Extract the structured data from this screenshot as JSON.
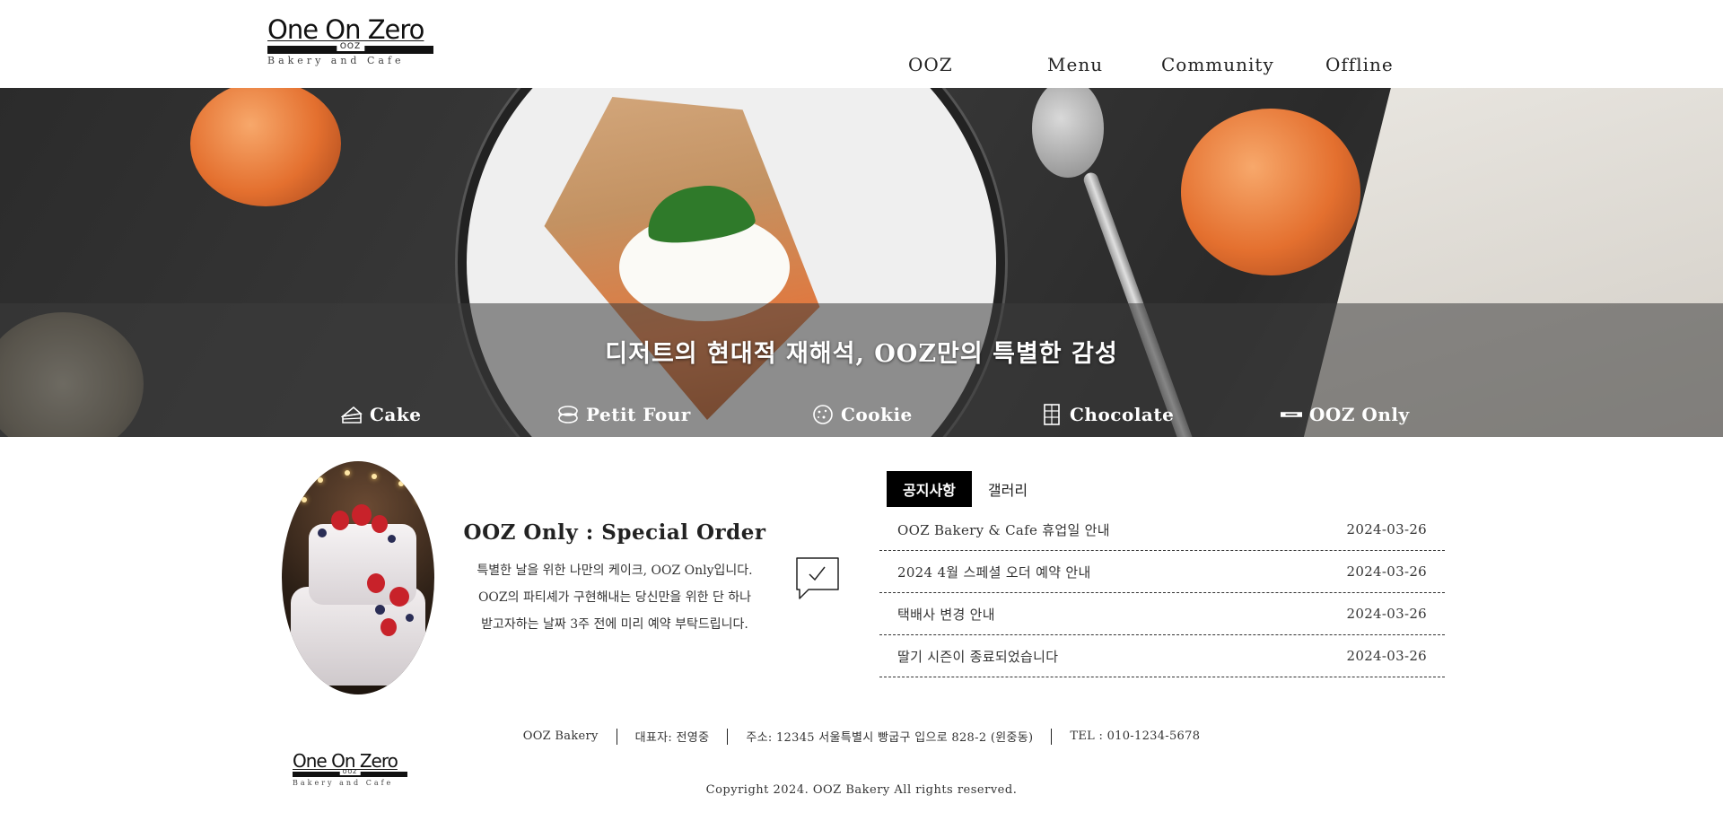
{
  "header": {
    "logo": {
      "main": "One On Zero",
      "mark": "OOZ",
      "tagline": "Bakery and Cafe"
    },
    "nav": [
      {
        "label": "OOZ"
      },
      {
        "label": "Menu"
      },
      {
        "label": "Community"
      },
      {
        "label": "Offline"
      }
    ]
  },
  "hero": {
    "title": "디저트의 현대적 재해석, OOZ만의 특별한 감성",
    "categories": [
      {
        "label": "Cake",
        "icon": "cake-icon"
      },
      {
        "label": "Petit Four",
        "icon": "macaron-icon"
      },
      {
        "label": "Cookie",
        "icon": "cookie-icon"
      },
      {
        "label": "Chocolate",
        "icon": "chocolate-bar-icon"
      },
      {
        "label": "OOZ Only",
        "icon": "ooz-only-icon"
      }
    ]
  },
  "special_order": {
    "title": "OOZ Only : Special Order",
    "desc": [
      "특별한 날을 위한 나만의 케이크, OOZ Only입니다.",
      "OOZ의 파티셰가 구현해내는 당신만을 위한 단 하나",
      "받고자하는 날짜 3주 전에 미리 예약 부탁드립니다."
    ],
    "chat_icon": "chat-check-icon"
  },
  "board": {
    "tabs": [
      {
        "label": "공지사항",
        "active": true
      },
      {
        "label": "갤러리",
        "active": false
      }
    ],
    "notices": [
      {
        "title": "OOZ Bakery & Cafe 휴업일 안내",
        "date": "2024-03-26"
      },
      {
        "title": "2024 4월 스페셜 오더 예약 안내",
        "date": "2024-03-26"
      },
      {
        "title": "택배사 변경 안내",
        "date": "2024-03-26"
      },
      {
        "title": "딸기 시즌이 종료되었습니다",
        "date": "2024-03-26"
      }
    ]
  },
  "footer": {
    "logo": {
      "main": "One On Zero",
      "mark": "OOZ",
      "tagline": "Bakery and Cafe"
    },
    "info": [
      "OOZ Bakery",
      "대표자: 전영중",
      "주소: 12345 서울특별시 빵굽구 입으로 828-2 (윈중동)",
      "TEL : 010-1234-5678"
    ],
    "copyright": "Copyright 2024. OOZ Bakery All rights reserved."
  },
  "colors": {
    "accent": "#000000",
    "text": "#222222",
    "hero_band": "#3c3c3c"
  }
}
